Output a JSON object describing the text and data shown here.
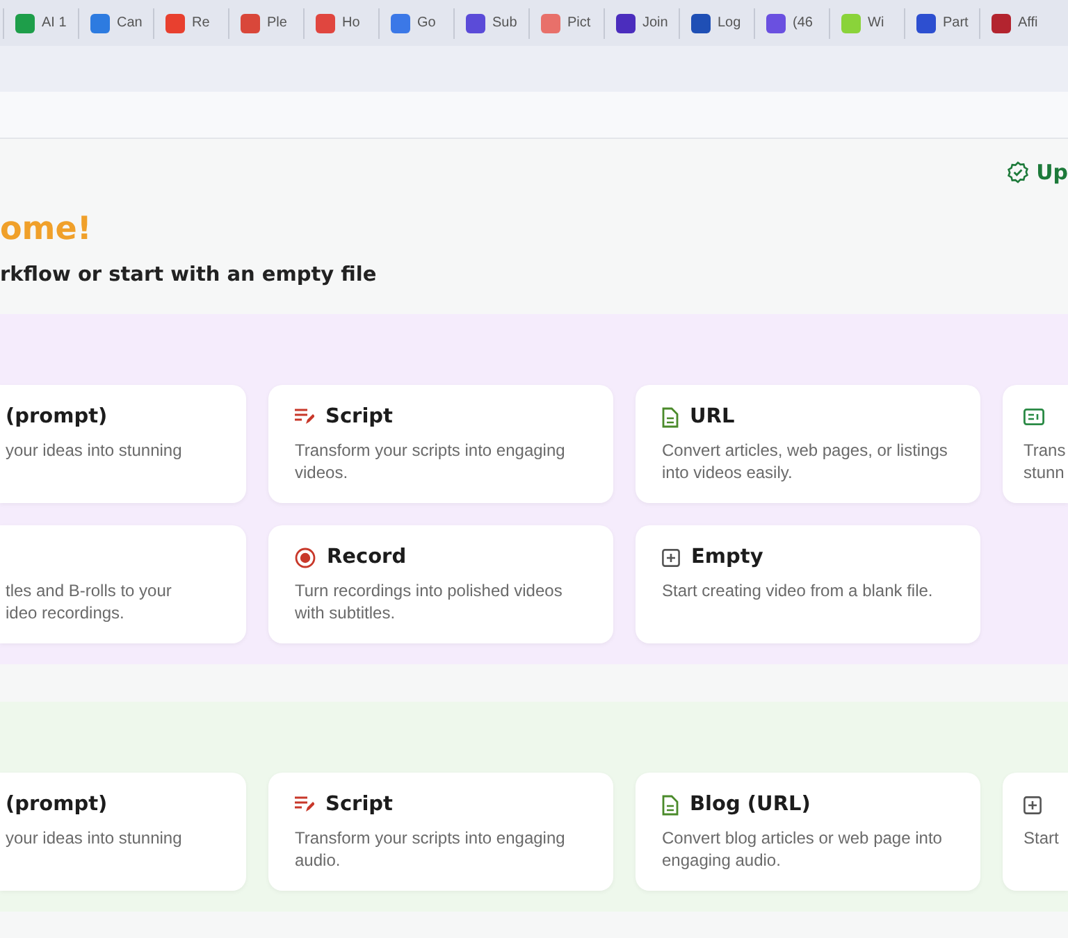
{
  "bookmarks": [
    {
      "label": "AI 1",
      "color": "#1e9e4a"
    },
    {
      "label": "Can",
      "color": "#2d7be0"
    },
    {
      "label": "Re",
      "color": "#e8402f"
    },
    {
      "label": "Ple",
      "color": "#d9473a"
    },
    {
      "label": "Ho",
      "color": "#e0463f"
    },
    {
      "label": "Go",
      "color": "#3b78e7"
    },
    {
      "label": "Sub",
      "color": "#5b4bd8"
    },
    {
      "label": "Pict",
      "color": "#e8706a"
    },
    {
      "label": "Join",
      "color": "#4b2dbd"
    },
    {
      "label": "Log",
      "color": "#1f4fb5"
    },
    {
      "label": "(46",
      "color": "#6a50e0"
    },
    {
      "label": "Wi",
      "color": "#8ad33a"
    },
    {
      "label": "Part",
      "color": "#2d4fd0"
    },
    {
      "label": "Affi",
      "color": "#b3242f"
    }
  ],
  "status": {
    "label": "Up"
  },
  "heading": "ome!",
  "subheading": "rkflow or start with an empty file",
  "sections": [
    {
      "kind": "video",
      "cards": [
        {
          "kind": "plain",
          "title": "(prompt)",
          "lines": [
            "your ideas into stunning"
          ]
        },
        {
          "kind": "script",
          "title": "Script",
          "lines": [
            "Transform your scripts into engaging",
            "videos."
          ]
        },
        {
          "kind": "document",
          "title": "URL",
          "lines": [
            "Convert articles, web pages, or listings",
            "into videos easily."
          ]
        },
        {
          "kind": "slides",
          "lines": [
            "Trans",
            "stunn"
          ]
        },
        {
          "kind": "plain",
          "lines": [
            "tles and B-rolls to your",
            "ideo recordings."
          ]
        },
        {
          "kind": "record",
          "title": "Record",
          "lines": [
            "Turn recordings into polished videos",
            "with subtitles."
          ]
        },
        {
          "kind": "empty",
          "title": "Empty",
          "lines": [
            "Start creating video from a blank file."
          ]
        }
      ]
    },
    {
      "kind": "audio",
      "cards": [
        {
          "kind": "plain",
          "title": "(prompt)",
          "lines": [
            "your ideas into stunning"
          ]
        },
        {
          "kind": "script",
          "title": "Script",
          "lines": [
            "Transform your scripts into engaging",
            "audio."
          ]
        },
        {
          "kind": "document",
          "title": "Blog (URL)",
          "lines": [
            "Convert blog articles or web page into",
            "engaging audio."
          ]
        },
        {
          "kind": "empty",
          "lines": [
            "Start"
          ]
        }
      ]
    }
  ]
}
